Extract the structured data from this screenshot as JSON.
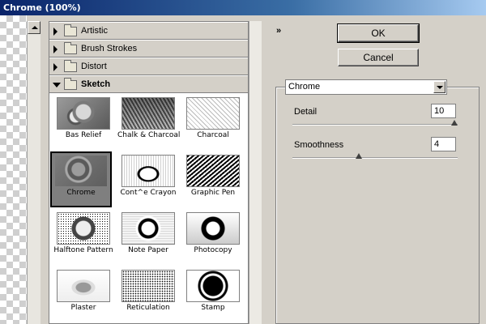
{
  "window": {
    "title": "Chrome (100%)"
  },
  "gallery": {
    "categories": [
      {
        "label": "Artistic",
        "expanded": false
      },
      {
        "label": "Brush Strokes",
        "expanded": false
      },
      {
        "label": "Distort",
        "expanded": false
      },
      {
        "label": "Sketch",
        "expanded": true
      }
    ],
    "filters": [
      {
        "label": "Bas Relief",
        "icon": "bas-relief-thumbnail"
      },
      {
        "label": "Chalk & Charcoal",
        "icon": "chalk-charcoal-thumbnail"
      },
      {
        "label": "Charcoal",
        "icon": "charcoal-thumbnail"
      },
      {
        "label": "Chrome",
        "icon": "chrome-thumbnail",
        "selected": true
      },
      {
        "label": "Cont^e Crayon",
        "icon": "conte-crayon-thumbnail"
      },
      {
        "label": "Graphic Pen",
        "icon": "graphic-pen-thumbnail"
      },
      {
        "label": "Halftone Pattern",
        "icon": "halftone-pattern-thumbnail"
      },
      {
        "label": "Note Paper",
        "icon": "note-paper-thumbnail"
      },
      {
        "label": "Photocopy",
        "icon": "photocopy-thumbnail"
      },
      {
        "label": "Plaster",
        "icon": "plaster-thumbnail"
      },
      {
        "label": "Reticulation",
        "icon": "reticulation-thumbnail"
      },
      {
        "label": "Stamp",
        "icon": "stamp-thumbnail"
      }
    ]
  },
  "buttons": {
    "ok": "OK",
    "cancel": "Cancel"
  },
  "collapse_glyph": "»",
  "settings": {
    "filter_select": "Chrome",
    "params": [
      {
        "label": "Detail",
        "value": "10",
        "fraction": 1.0
      },
      {
        "label": "Smoothness",
        "value": "4",
        "fraction": 0.4
      }
    ]
  }
}
